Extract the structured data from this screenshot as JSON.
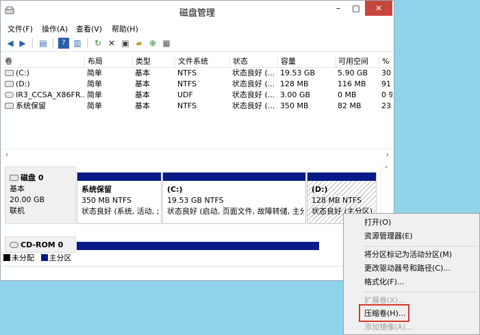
{
  "window": {
    "title": "磁盘管理",
    "minimize": "–",
    "maximize": "□",
    "close": "✕"
  },
  "menu": [
    "文件(F)",
    "操作(A)",
    "查看(V)",
    "帮助(H)"
  ],
  "toolbar_icons": [
    "back-icon",
    "forward-icon",
    "panel-icon",
    "help-icon",
    "panel2-icon",
    "refresh-icon",
    "delete-icon",
    "properties-icon",
    "open-icon",
    "zoom-icon",
    "wizard-icon"
  ],
  "list": {
    "headers": [
      "卷",
      "布局",
      "类型",
      "文件系统",
      "状态",
      "容量",
      "可用空间",
      "%"
    ],
    "rows": [
      [
        "(C:)",
        "简单",
        "基本",
        "NTFS",
        "状态良好 (...",
        "19.53 GB",
        "5.90 GB",
        "30"
      ],
      [
        "(D:)",
        "简单",
        "基本",
        "NTFS",
        "状态良好 (...",
        "128 MB",
        "116 MB",
        "91"
      ],
      [
        "IR3_CCSA_X86FR...",
        "简单",
        "基本",
        "UDF",
        "状态良好 (...",
        "3.00 GB",
        "0 MB",
        "0 9"
      ],
      [
        "系统保留",
        "简单",
        "基本",
        "NTFS",
        "状态良好 (...",
        "350 MB",
        "82 MB",
        "23"
      ]
    ]
  },
  "disk0": {
    "name": "磁盘 0",
    "type": "基本",
    "size": "20.00 GB",
    "state": "联机",
    "partitions": [
      {
        "name": "系统保留",
        "size": "350 MB NTFS",
        "status": "状态良好 (系统, 活动, ;"
      },
      {
        "name": "(C:)",
        "size": "19.53 GB NTFS",
        "status": "状态良好 (启动, 页面文件, 故障转储, 主分"
      },
      {
        "name": "(D:)",
        "size": "128 MB NTFS",
        "status": "状态良好 (主分区)"
      }
    ]
  },
  "cdrom": {
    "name": "CD-ROM 0"
  },
  "legend": {
    "unallocated": "未分配",
    "primary": "主分区"
  },
  "context_menu": {
    "open": "打开(O)",
    "explorer": "资源管理器(E)",
    "mark_active": "将分区标记为活动分区(M)",
    "change_letter": "更改驱动器号和路径(C)...",
    "format": "格式化(F)...",
    "extend": "扩展卷(X)...",
    "shrink": "压缩卷(H)...",
    "mirror": "添加镜像(A)..."
  }
}
